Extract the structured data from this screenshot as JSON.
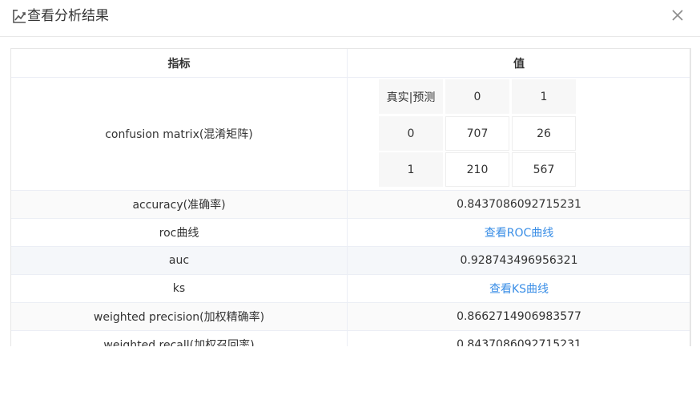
{
  "dialog": {
    "title": "查看分析结果"
  },
  "table": {
    "headers": {
      "metric": "指标",
      "value": "值"
    },
    "confusion_matrix": {
      "label": "confusion matrix(混淆矩阵)",
      "corner": "真实|预测",
      "col_labels": [
        "0",
        "1"
      ],
      "rows": [
        {
          "label": "0",
          "values": [
            "707",
            "26"
          ]
        },
        {
          "label": "1",
          "values": [
            "210",
            "567"
          ]
        }
      ]
    },
    "rows": [
      {
        "label": "accuracy(准确率)",
        "value": "0.8437086092715231"
      },
      {
        "label": "roc曲线",
        "link": "查看ROC曲线"
      },
      {
        "label": "auc",
        "value": "0.928743496956321"
      },
      {
        "label": "ks",
        "link": "查看KS曲线"
      },
      {
        "label": "weighted precision(加权精确率)",
        "value": "0.8662714906983577"
      },
      {
        "label": "weighted recall(加权召回率)",
        "value": "0.8437086092715231"
      }
    ]
  }
}
